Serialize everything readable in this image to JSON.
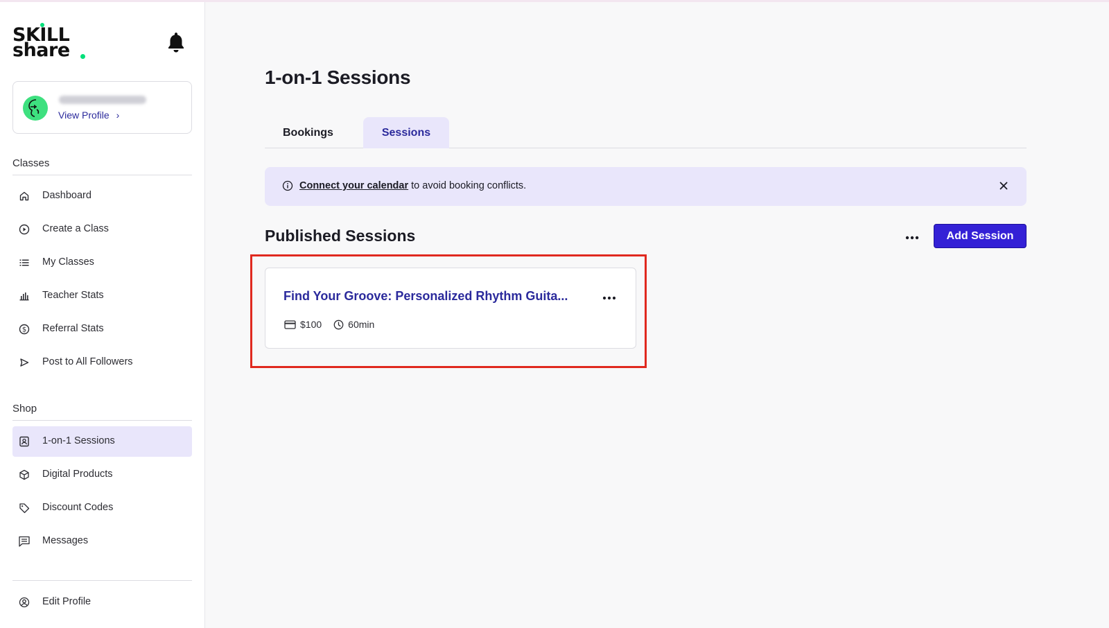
{
  "brand": {
    "line1": "SKILL",
    "line2": "share",
    "accent_color": "#00e07a"
  },
  "profile": {
    "view_profile_label": "View Profile",
    "chevron": "›"
  },
  "sidebar": {
    "classes_heading": "Classes",
    "classes_items": [
      {
        "label": "Dashboard",
        "icon": "home-icon"
      },
      {
        "label": "Create a Class",
        "icon": "play-circle-icon"
      },
      {
        "label": "My Classes",
        "icon": "list-icon"
      },
      {
        "label": "Teacher Stats",
        "icon": "bar-chart-icon"
      },
      {
        "label": "Referral Stats",
        "icon": "dollar-circle-icon"
      },
      {
        "label": "Post to All Followers",
        "icon": "send-icon"
      }
    ],
    "shop_heading": "Shop",
    "shop_items": [
      {
        "label": "1-on-1 Sessions",
        "icon": "person-card-icon",
        "active": true
      },
      {
        "label": "Digital Products",
        "icon": "box-icon"
      },
      {
        "label": "Discount Codes",
        "icon": "tag-icon"
      },
      {
        "label": "Messages",
        "icon": "message-icon"
      }
    ],
    "footer_item": {
      "label": "Edit Profile",
      "icon": "user-circle-icon"
    }
  },
  "main": {
    "title": "1-on-1 Sessions",
    "tabs": [
      {
        "label": "Bookings",
        "active": false
      },
      {
        "label": "Sessions",
        "active": true
      }
    ],
    "banner": {
      "link_text": "Connect your calendar",
      "text": " to avoid booking conflicts."
    },
    "section_title": "Published Sessions",
    "add_button_label": "Add Session",
    "sessions": [
      {
        "title": "Find Your Groove: Personalized Rhythm Guita...",
        "price": "$100",
        "duration": "60min"
      }
    ]
  },
  "colors": {
    "primary": "#3421d6",
    "link": "#2b2a9c",
    "active_bg": "#e9e6fb",
    "highlight": "#e0291f"
  }
}
